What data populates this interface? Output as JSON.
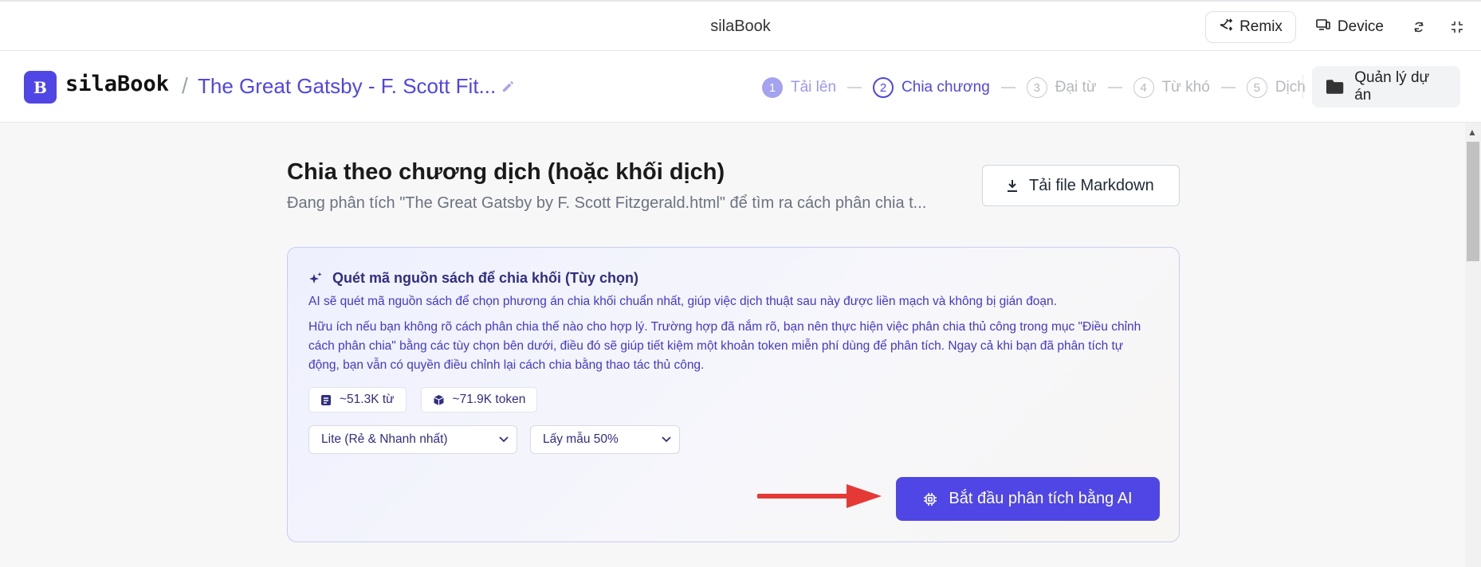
{
  "topbar": {
    "title": "silaBook",
    "remix_label": "Remix",
    "device_label": "Device"
  },
  "header": {
    "logo_letter": "B",
    "brand": "silaBook",
    "separator": "/",
    "book_title": "The Great Gatsby - F. Scott Fit...",
    "steps": [
      {
        "num": "1",
        "label": "Tải lên",
        "state": "done"
      },
      {
        "num": "2",
        "label": "Chia chương",
        "state": "active"
      },
      {
        "num": "3",
        "label": "Đại từ",
        "state": "todo"
      },
      {
        "num": "4",
        "label": "Từ khó",
        "state": "todo"
      },
      {
        "num": "5",
        "label": "Dịch",
        "state": "todo"
      }
    ],
    "project_button_label": "Quản lý dự án"
  },
  "main": {
    "heading": "Chia theo chương dịch (hoặc khối dịch)",
    "subtitle": "Đang phân tích \"The Great Gatsby by F. Scott Fitzgerald.html\" để tìm ra cách phân chia t...",
    "download_button_label": "Tải file Markdown"
  },
  "card": {
    "title": "Quét mã nguồn sách để chia khối (Tùy chọn)",
    "line1": "AI sẽ quét mã nguồn sách để chọn phương án chia khối chuẩn nhất, giúp việc dịch thuật sau này được liền mạch và không bị gián đoạn.",
    "paragraph": "Hữu ích nếu bạn không rõ cách phân chia thế nào cho hợp lý. Trường hợp đã nắm rõ, bạn nên thực hiện việc phân chia thủ công trong mục \"Điều chỉnh cách phân chia\" bằng các tùy chọn bên dưới, điều đó sẽ giúp tiết kiệm một khoản token miễn phí dùng để phân tích. Ngay cả khi bạn đã phân tích tự động, bạn vẫn có quyền điều chỉnh lại cách chia bằng thao tác thủ công.",
    "word_count": "~51.3K từ",
    "token_count": "~71.9K token",
    "model_select": "Lite (Rẻ & Nhanh nhất)",
    "sample_select": "Lấy mẫu 50%",
    "start_button_label": "Bắt đầu phân tích bằng AI"
  },
  "colors": {
    "accent": "#4f46e5",
    "arrow": "#e53935"
  }
}
